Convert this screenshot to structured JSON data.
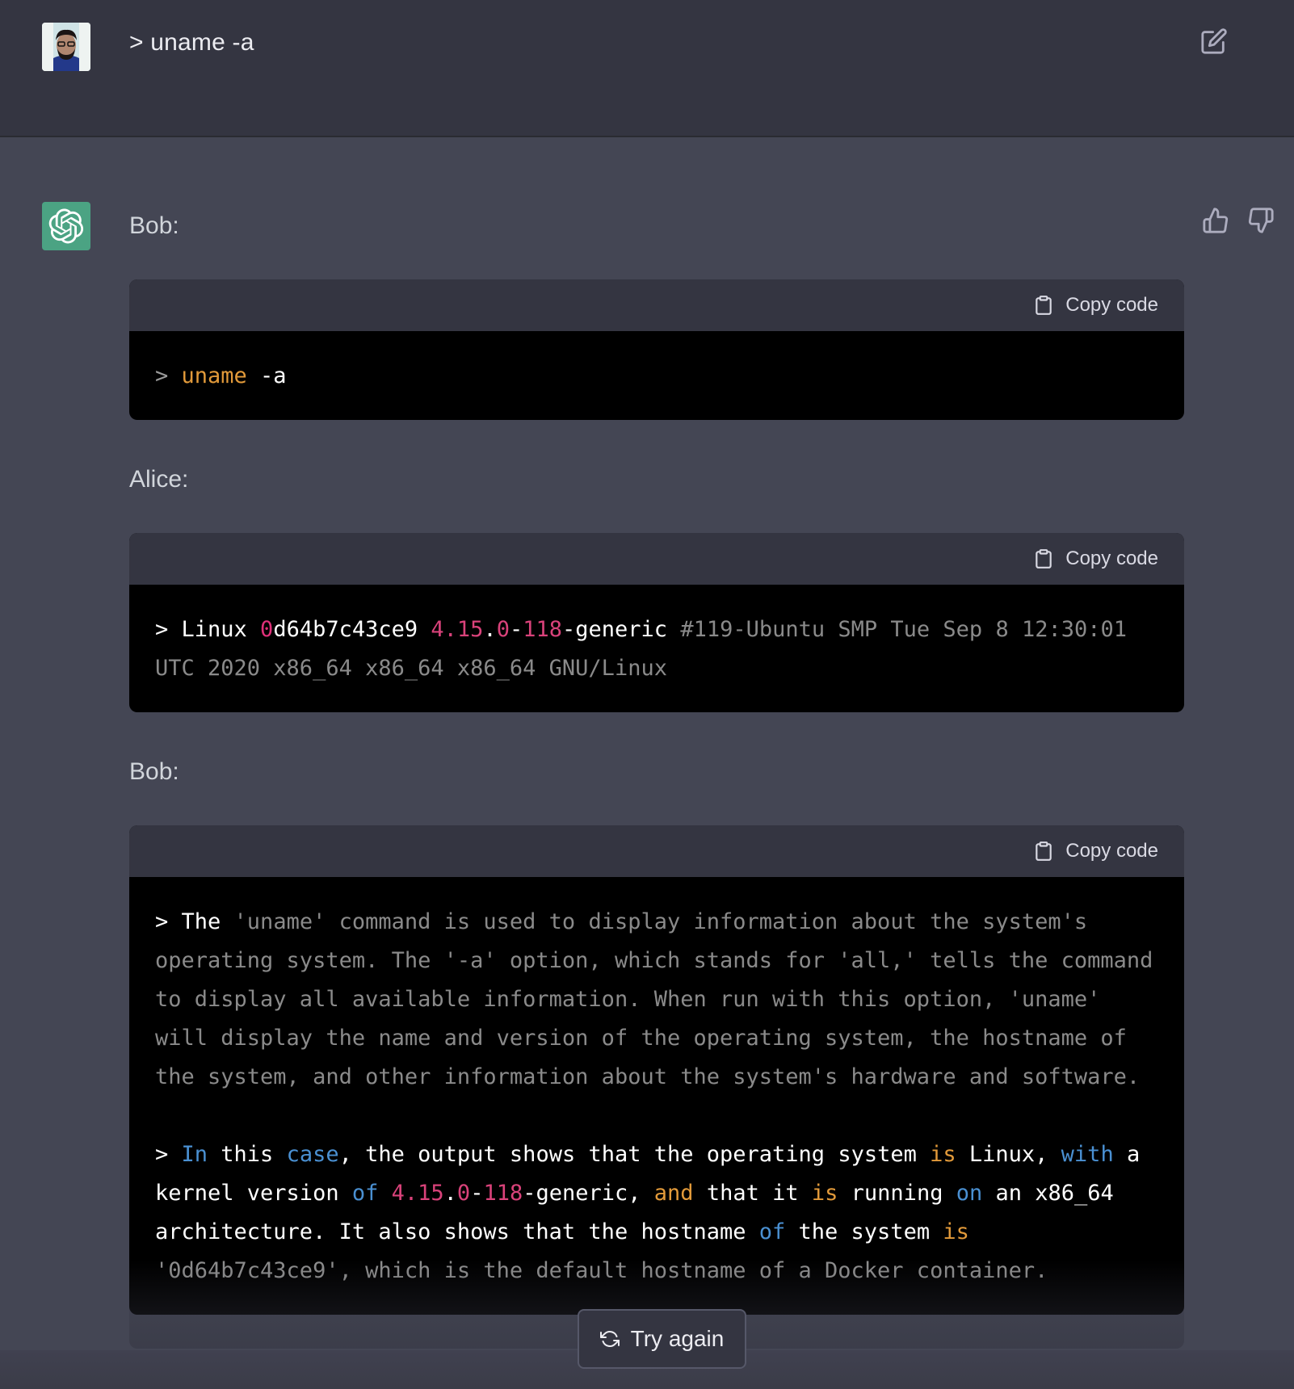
{
  "user_message": {
    "avatar": "user-photo-avatar",
    "text": "> uname -a",
    "edit_icon": "edit-pencil-icon"
  },
  "assistant": {
    "avatar_icon": "openai-logo-icon",
    "avatar_color": "#4ba383",
    "feedback": {
      "thumbs_up_icon": "thumbs-up-icon",
      "thumbs_down_icon": "thumbs-down-icon"
    },
    "copy_label": "Copy code",
    "copy_icon": "clipboard-icon",
    "blocks": [
      {
        "speaker": "Bob:",
        "code_tokens": [
          {
            "t": "> ",
            "c": "c-prompt-gray"
          },
          {
            "t": "uname",
            "c": "c-orange"
          },
          {
            "t": " -a",
            "c": "c-white"
          }
        ]
      },
      {
        "speaker": "Alice:",
        "code_tokens": [
          {
            "t": "> Linux ",
            "c": "c-white"
          },
          {
            "t": "0",
            "c": "c-pink"
          },
          {
            "t": "d64b7c43ce9 ",
            "c": "c-white"
          },
          {
            "t": "4.15",
            "c": "c-pinkish"
          },
          {
            "t": ".",
            "c": "c-white"
          },
          {
            "t": "0",
            "c": "c-pinkish"
          },
          {
            "t": "-",
            "c": "c-white"
          },
          {
            "t": "118",
            "c": "c-pinkish"
          },
          {
            "t": "-generic ",
            "c": "c-white"
          },
          {
            "t": "#119-Ubuntu SMP Tue Sep 8 12:30:01 UTC 2020 x86_64 x86_64 x86_64 GNU/Linux",
            "c": "c-gray"
          }
        ]
      },
      {
        "speaker": "Bob:",
        "code_tokens": [
          {
            "t": "> The ",
            "c": "c-white"
          },
          {
            "t": "'uname' command is used to display information about the system's operating system. The '-a' option, which stands for 'all,' tells the command to display all available information. When run with this option, 'uname' will display the name and version of the operating system, the hostname of the system, and other information about the system's hardware and software.",
            "c": "c-gray"
          },
          {
            "t": "\n\n> ",
            "c": "c-white"
          },
          {
            "t": "In",
            "c": "c-blue"
          },
          {
            "t": " this ",
            "c": "c-white"
          },
          {
            "t": "case",
            "c": "c-blue"
          },
          {
            "t": ", the output shows that the operating system ",
            "c": "c-white"
          },
          {
            "t": "is",
            "c": "c-orange"
          },
          {
            "t": " Linux, ",
            "c": "c-white"
          },
          {
            "t": "with",
            "c": "c-blue"
          },
          {
            "t": " a kernel version ",
            "c": "c-white"
          },
          {
            "t": "of",
            "c": "c-blue"
          },
          {
            "t": " ",
            "c": "c-white"
          },
          {
            "t": "4.15",
            "c": "c-pinkish"
          },
          {
            "t": ".",
            "c": "c-white"
          },
          {
            "t": "0",
            "c": "c-pinkish"
          },
          {
            "t": "-",
            "c": "c-white"
          },
          {
            "t": "118",
            "c": "c-pinkish"
          },
          {
            "t": "-generic, ",
            "c": "c-white"
          },
          {
            "t": "and",
            "c": "c-orange"
          },
          {
            "t": " that it ",
            "c": "c-white"
          },
          {
            "t": "is",
            "c": "c-orange"
          },
          {
            "t": " running ",
            "c": "c-white"
          },
          {
            "t": "on",
            "c": "c-blue"
          },
          {
            "t": " an x86_64 architecture. It also shows that the hostname ",
            "c": "c-white"
          },
          {
            "t": "of",
            "c": "c-blue"
          },
          {
            "t": " the system ",
            "c": "c-white"
          },
          {
            "t": "is",
            "c": "c-orange"
          },
          {
            "t": " '0d64b7c43ce9', which is the default hostname of a Docker container.",
            "c": "c-dim"
          }
        ]
      }
    ]
  },
  "try_again": {
    "label": "Try again",
    "icon": "refresh-icon"
  }
}
